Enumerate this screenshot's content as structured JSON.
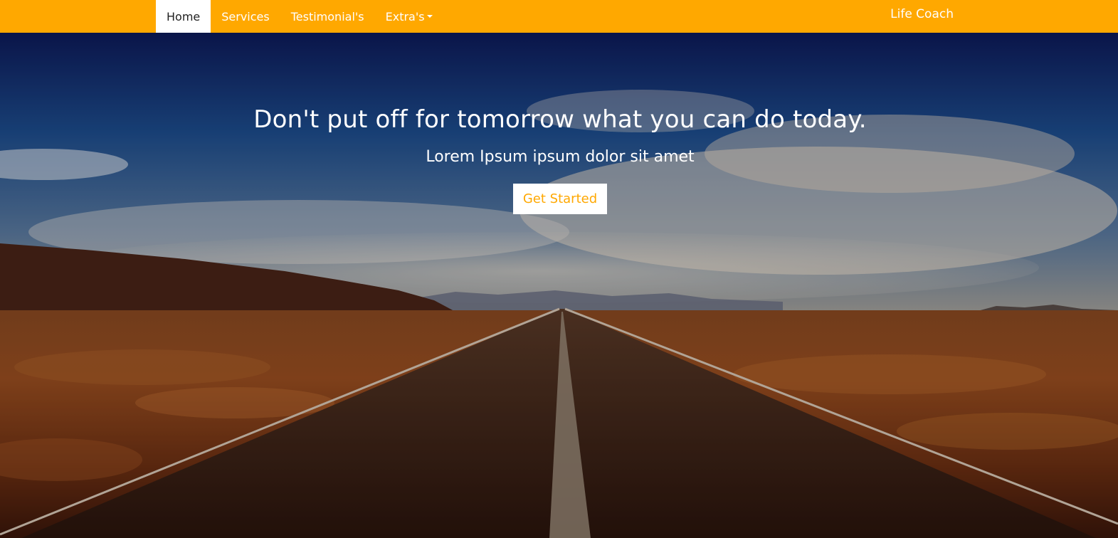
{
  "navbar": {
    "items": [
      {
        "label": "Home",
        "active": true
      },
      {
        "label": "Services",
        "active": false
      },
      {
        "label": "Testimonial's",
        "active": false
      },
      {
        "label": "Extra's",
        "active": false,
        "dropdown": true
      }
    ],
    "brand": "Life Coach",
    "background_color": "#ffa800"
  },
  "hero": {
    "title": "Don't put off for tomorrow what you can do today.",
    "subtitle": "Lorem Ipsum ipsum dolor sit amet",
    "cta_label": "Get Started",
    "cta_text_color": "#ffa800",
    "background_scene": "desert-road-under-cloudy-sky"
  }
}
